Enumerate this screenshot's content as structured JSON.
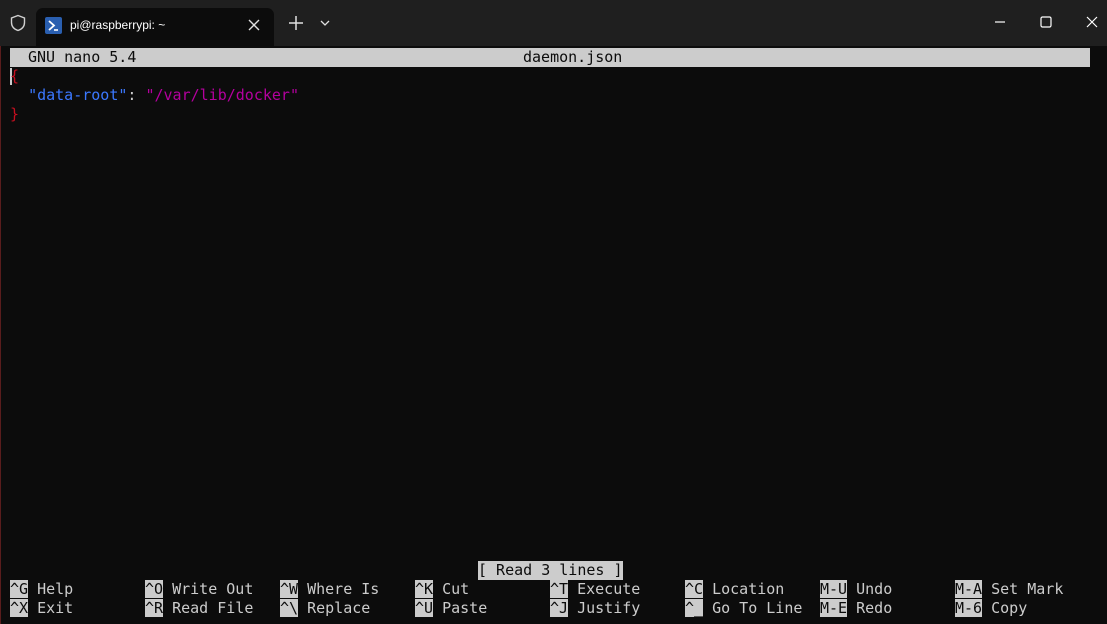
{
  "window": {
    "tab_title": "pi@raspberrypi: ~",
    "icons": {
      "shield": "shield-icon",
      "tab": "powershell-icon",
      "close": "close-icon",
      "new_tab": "plus-icon",
      "dropdown": "chevron-down-icon",
      "minimize": "minimize-icon",
      "maximize": "maximize-icon",
      "window_close": "close-icon"
    }
  },
  "nano": {
    "version": "GNU nano 5.4",
    "filename": "daemon.json",
    "content": {
      "line1": "{",
      "line2_key": "\"data-root\"",
      "line2_sep": ": ",
      "line2_value": "\"/var/lib/docker\"",
      "line3": "}"
    },
    "status": "[ Read 3 lines ]",
    "shortcuts": [
      {
        "key": "^G",
        "label": "Help"
      },
      {
        "key": "^O",
        "label": "Write Out"
      },
      {
        "key": "^W",
        "label": "Where Is"
      },
      {
        "key": "^K",
        "label": "Cut"
      },
      {
        "key": "^T",
        "label": "Execute"
      },
      {
        "key": "^C",
        "label": "Location"
      },
      {
        "key": "M-U",
        "label": "Undo"
      },
      {
        "key": "M-A",
        "label": "Set Mark"
      },
      {
        "key": "^X",
        "label": "Exit"
      },
      {
        "key": "^R",
        "label": "Read File"
      },
      {
        "key": "^\\",
        "label": "Replace"
      },
      {
        "key": "^U",
        "label": "Paste"
      },
      {
        "key": "^J",
        "label": "Justify"
      },
      {
        "key": "^_",
        "label": "Go To Line"
      },
      {
        "key": "M-E",
        "label": "Redo"
      },
      {
        "key": "M-6",
        "label": "Copy"
      }
    ]
  },
  "colors": {
    "terminal_bg": "#0c0c0c",
    "text": "#cccccc",
    "brace": "#c50f1f",
    "json_key": "#3b78ff",
    "json_string": "#b4009e"
  }
}
